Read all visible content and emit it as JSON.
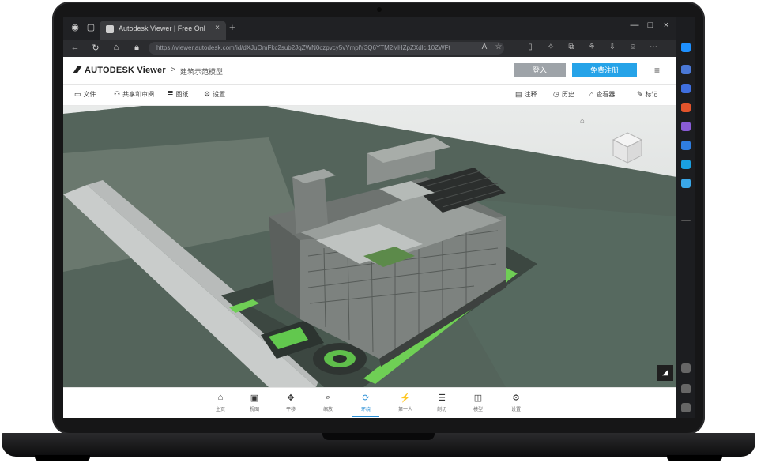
{
  "browser": {
    "tab_title": "Autodesk Viewer | Free Online File Viewer",
    "tab_close": "×",
    "new_tab": "+",
    "url": "https://viewer.autodesk.com/id/dXJuOmFkc2sub2JqZWN0czpvcy5vYmplY3Q6YTM2MHZpZXdlci10ZWFt",
    "window_min": "—",
    "window_max": "□",
    "window_close": "×"
  },
  "app": {
    "logo_text": "AUTODESK Viewer",
    "breadcrumb_sep": ">",
    "breadcrumb": "建筑示范模型",
    "btn_secondary": "登入",
    "btn_primary": "免费注册",
    "menu_glyph": "≡"
  },
  "toolbar": {
    "items": [
      {
        "icon": "▭",
        "label": "文件"
      },
      {
        "icon": "⚇",
        "label": "共享和审阅"
      },
      {
        "icon": "≣",
        "label": "图纸"
      },
      {
        "icon": "⚙",
        "label": "设置"
      }
    ],
    "right_items": [
      {
        "icon": "▤",
        "label": "注释"
      },
      {
        "icon": "◷",
        "label": "历史"
      },
      {
        "icon": "⌂",
        "label": "查看器"
      },
      {
        "icon": "✎",
        "label": "标记"
      }
    ]
  },
  "viewport": {
    "home_glyph": "⌂",
    "corner_glyph": "◢"
  },
  "bottom_tools": [
    {
      "icon": "⌂",
      "label": "主页",
      "active": false
    },
    {
      "icon": "▣",
      "label": "视图",
      "active": false
    },
    {
      "icon": "✥",
      "label": "平移",
      "active": false
    },
    {
      "icon": "⌕",
      "label": "缩放",
      "active": false
    },
    {
      "icon": "⟳",
      "label": "环绕",
      "active": true
    },
    {
      "icon": "⚡",
      "label": "第一人",
      "active": false
    },
    {
      "icon": "☰",
      "label": "剖切",
      "active": false
    },
    {
      "icon": "◫",
      "label": "模型",
      "active": false
    },
    {
      "icon": "⚙",
      "label": "设置",
      "active": false
    }
  ],
  "colors": {
    "accent": "#26a3e8",
    "secondary_btn": "#9ea3a8",
    "browser_dark": "#202124"
  }
}
